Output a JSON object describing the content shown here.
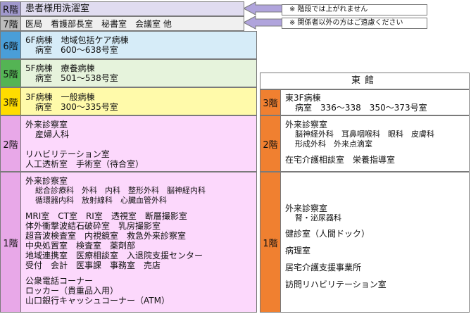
{
  "floors": {
    "r": {
      "label": "R階",
      "lines": [
        "患者様用洗濯室"
      ]
    },
    "f7": {
      "label": "7階",
      "lines": [
        "医局　看護部長室　秘書室　会議室 他"
      ]
    },
    "f6": {
      "label": "6階",
      "lines": [
        "6F病棟　地域包括ケア病棟",
        "病室　600～638号室"
      ]
    },
    "f5": {
      "label": "5階",
      "lines": [
        "5F病棟　療養病棟",
        "病室　501～538号室"
      ]
    },
    "f3": {
      "label": "3階",
      "lines": [
        "3F病棟　一般病棟",
        "病室　300～335号室"
      ]
    },
    "f2": {
      "label": "2階",
      "lines": [
        "外来診察室",
        "産婦人科",
        "リハビリテーション室",
        "人工透析室　手術室（待合室）"
      ]
    },
    "f1": {
      "label": "1階",
      "lines": [
        "外来診察室",
        "総合診療科　外科　内科　整形外科　脳神経内科",
        "循環器内科　放射線科　心臓血管外科",
        "MRI室　CT室　RI室　透視室　断層撮影室",
        "体外衝撃波結石破砕室　乳房撮影室",
        "超音波検査室　内視鏡室　救急外来診察室",
        "中央処置室　検査室　薬剤部",
        "地域連携室　医療相談室　入退院支援センター",
        "受付　会計　医事課　事務室　売店",
        "公衆電話コーナー",
        "ロッカー（貴重品入用）",
        "山口銀行キャッシュコーナー（ATM）"
      ]
    }
  },
  "notes": {
    "stairs": "※ 階段では上がれません",
    "staff": "※ 関係者以外の方はご遠慮ください"
  },
  "east": {
    "title": "東館",
    "f3": {
      "label": "3階",
      "lines": [
        "東3F病棟",
        "病室　336～338　350～373号室"
      ]
    },
    "f2": {
      "label": "2階",
      "lines": [
        "外来診察室",
        "脳神経外科　耳鼻咽喉科　眼科　皮膚科",
        "形成外科　外来点滴室",
        "在宅介護相談室　栄養指導室"
      ]
    },
    "f1": {
      "label": "1階",
      "lines": [
        "外来診察室",
        "腎・泌尿器科",
        "健診室（人間ドック）",
        "病理室",
        "居宅介護支援事業所",
        "訪問リハビリテーション室"
      ]
    }
  },
  "colors": {
    "r_label": "#a098cc",
    "r_bg": "#e0dcf0",
    "f7_label": "#bcbcbc",
    "f7_bg": "#f0f0f0",
    "f6_label": "#4a9ed8",
    "f6_bg": "#d6ecf8",
    "f5_label": "#54b454",
    "f5_bg": "#e6f3dc",
    "f3_label": "#ffdc00",
    "f3_bg": "#fffaaa",
    "f21_label": "#e8a8e8",
    "f21_bg": "#fcd8fc",
    "east_label": "#f08030",
    "east_bg": "#ffffff",
    "arrow": "#b0a4dc"
  }
}
